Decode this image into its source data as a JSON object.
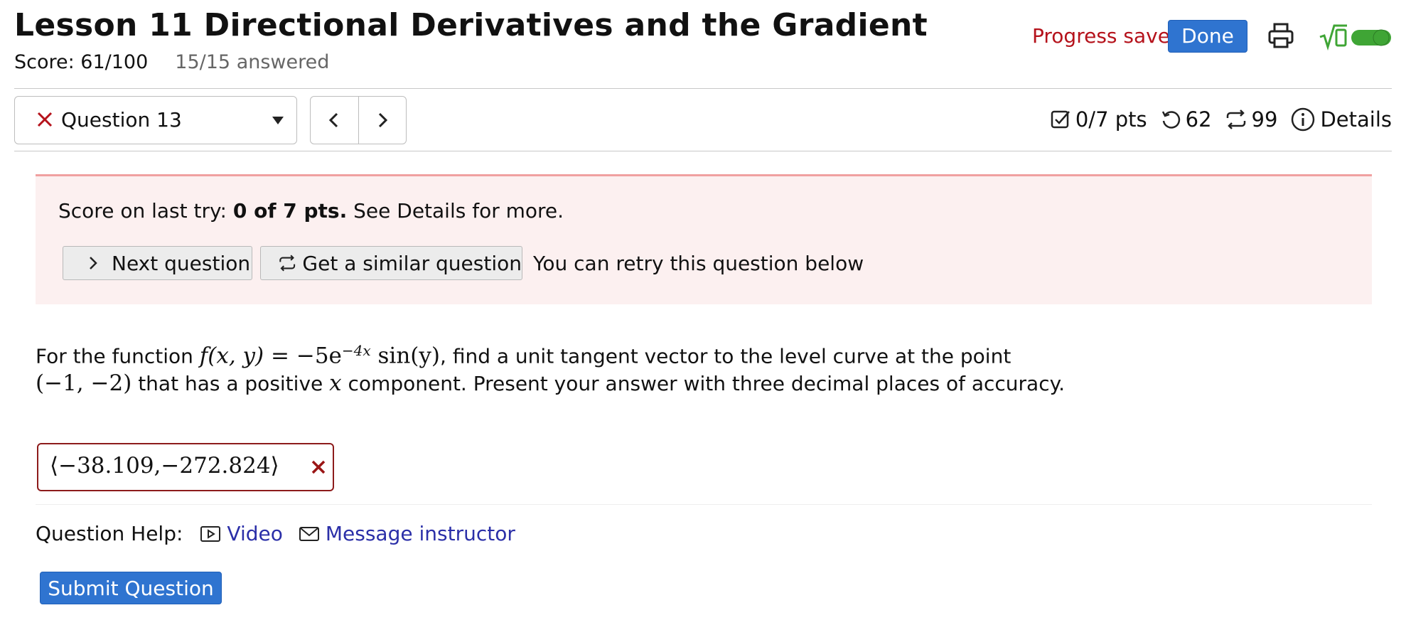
{
  "header": {
    "title": "Lesson 11 Directional Derivatives and the Gradient",
    "score_text": "Score: 61/100",
    "answered_text": "15/15 answered",
    "progress_saved": "Progress saved",
    "done_label": "Done",
    "printer_icon": "printer-icon",
    "math_toggle_icon": "sqrt-zero-toggle-icon",
    "toggle_on": true,
    "toggle_color": "#3fa535"
  },
  "question_nav": {
    "selected_question": "Question 13",
    "status_icon": "x-mark-icon",
    "prev_icon": "chevron-left-icon",
    "next_icon": "chevron-right-icon"
  },
  "meta": {
    "points": "0/7 pts",
    "retries": "62",
    "versions": "99",
    "details_label": "Details"
  },
  "alert": {
    "score_prefix": "Score on last try: ",
    "score_bold": "0 of 7 pts.",
    "score_suffix": " See Details for more.",
    "next_question_label": "Next question",
    "similar_question_label": "Get a similar question",
    "retry_text": "You can retry this question below"
  },
  "problem": {
    "text_1": "For the function ",
    "func_lhs": "f(x, y)",
    "func_eq": " = −5e",
    "func_exp": "−4x",
    "func_rest": " sin(y)",
    "text_2": ", find a unit tangent vector to the level curve at the point",
    "point": "(−1, −2)",
    "text_3": " that has a positive ",
    "var_x": "x",
    "text_4": " component. Present your answer with three decimal places of accuracy."
  },
  "answer": {
    "value": "⟨−38.109,−272.824⟩",
    "status": "incorrect"
  },
  "help": {
    "label": "Question Help:",
    "video_label": "Video",
    "message_label": "Message instructor"
  },
  "submit_label": "Submit Question",
  "colors": {
    "primary_blue": "#2f74d0",
    "error_red": "#b5121b",
    "alert_bg": "#fcf0f0",
    "link_blue": "#2b2fa8"
  }
}
